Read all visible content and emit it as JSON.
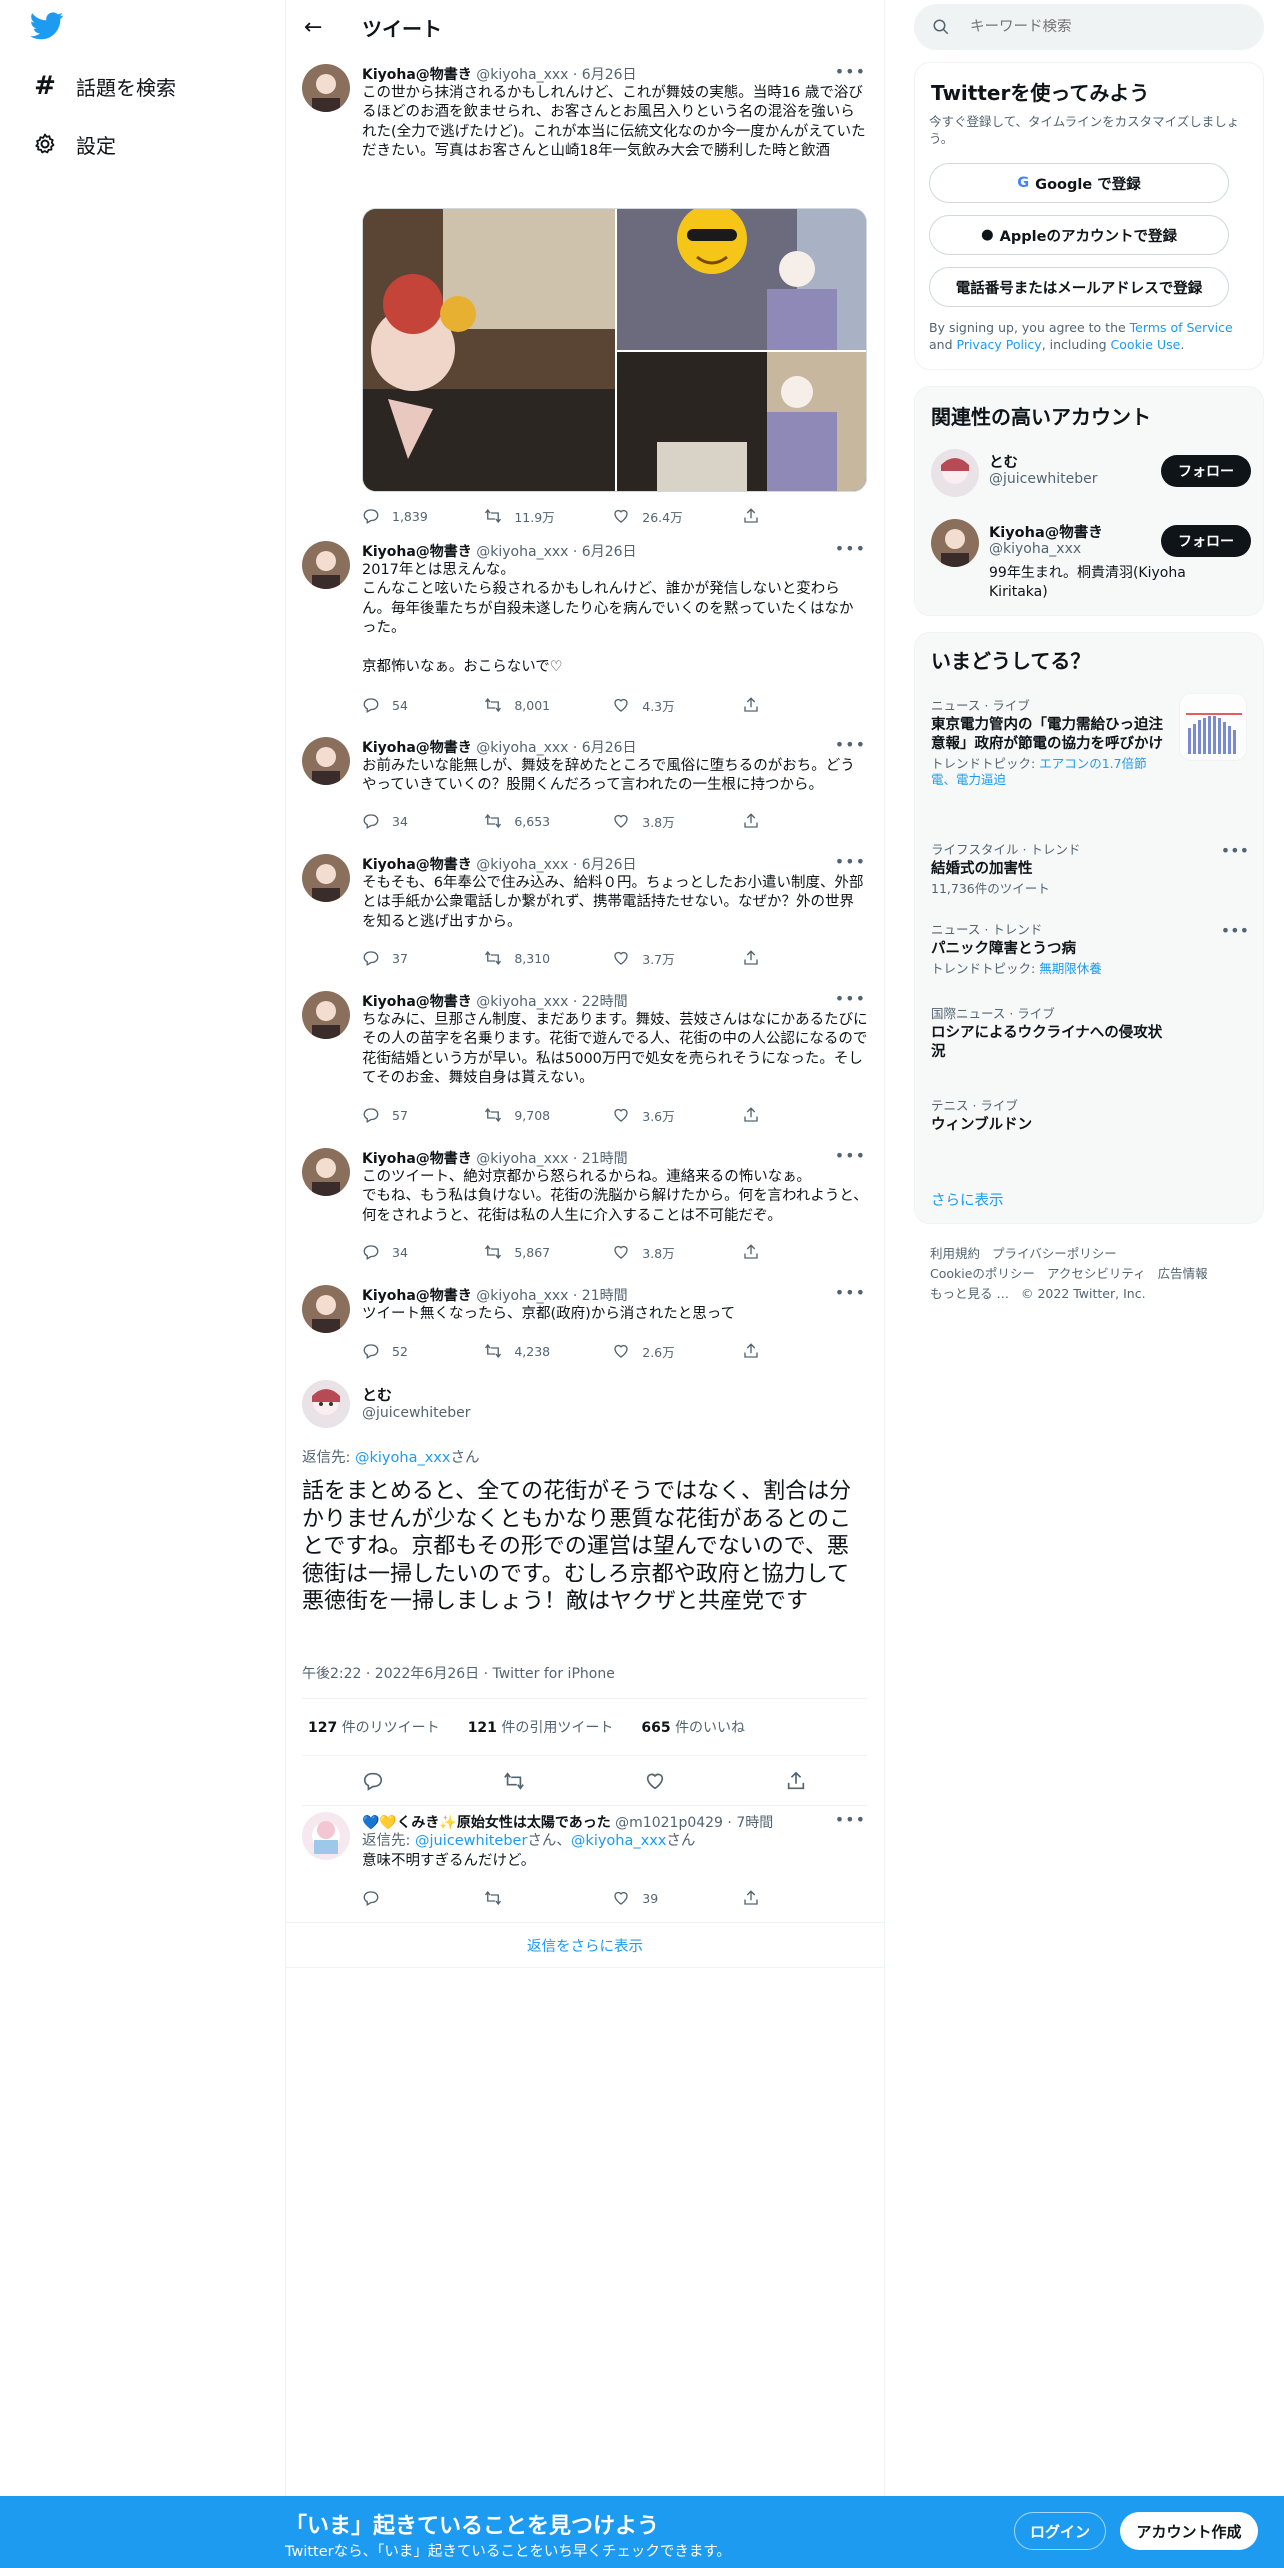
{
  "colors": {
    "accent": "#1d9bf0",
    "text": "#0f1419",
    "muted": "#536471",
    "banner": "#1d9bf0"
  },
  "nav": {
    "logo": "twitter-bird-icon",
    "items": [
      {
        "icon": "hashtag-icon",
        "label": "話題を検索"
      },
      {
        "icon": "gear-icon",
        "label": "設定"
      }
    ]
  },
  "header": {
    "title": "ツイート"
  },
  "tweets": [
    {
      "name": "Kiyoha@物書き",
      "handle": "@kiyoha_xxx",
      "time": "6月26日",
      "text": "この世から抹消されるかもしれんけど、これが舞妓の実態。当時16 歳で浴びるほどのお酒を飲ませられ、お客さんとお風呂入りという名の混浴を強いられた(全力で逃げたけど)。これが本当に伝統文化なのか今一度かんがえていただきたい。写真はお客さんと山崎18年一気飲み大会で勝利した時と飲酒",
      "replies": "1,839",
      "retweets": "11.9万",
      "likes": "26.4万"
    },
    {
      "name": "Kiyoha@物書き",
      "handle": "@kiyoha_xxx",
      "time": "6月26日",
      "text": "2017年とは思えんな。\nこんなこと呟いたら殺されるかもしれんけど、誰かが発信しないと変わらん。毎年後輩たちが自殺未遂したり心を病んでいくのを黙っていたくはなかった。\n\n京都怖いなぁ。おこらないで♡",
      "replies": "54",
      "retweets": "8,001",
      "likes": "4.3万"
    },
    {
      "name": "Kiyoha@物書き",
      "handle": "@kiyoha_xxx",
      "time": "6月26日",
      "text": "お前みたいな能無しが、舞妓を辞めたところで風俗に堕ちるのがおち。どうやっていきていくの？股開くんだろって言われたの一生根に持つから。",
      "replies": "34",
      "retweets": "6,653",
      "likes": "3.8万"
    },
    {
      "name": "Kiyoha@物書き",
      "handle": "@kiyoha_xxx",
      "time": "6月26日",
      "text": "そもそも、6年奉公で住み込み、給料０円。ちょっとしたお小遣い制度、外部とは手紙か公衆電話しか繋がれず、携帯電話持たせない。なぜか？外の世界を知ると逃げ出すから。",
      "replies": "37",
      "retweets": "8,310",
      "likes": "3.7万"
    },
    {
      "name": "Kiyoha@物書き",
      "handle": "@kiyoha_xxx",
      "time": "22時間",
      "text": "ちなみに、旦那さん制度、まだあります。舞妓、芸妓さんはなにかあるたびにその人の苗字を名乗ります。花街で遊んでる人、花街の中の人公認になるので花街結婚という方が早い。私は5000万円で処女を売られそうになった。そしてそのお金、舞妓自身は貰えない。",
      "replies": "57",
      "retweets": "9,708",
      "likes": "3.6万"
    },
    {
      "name": "Kiyoha@物書き",
      "handle": "@kiyoha_xxx",
      "time": "21時間",
      "text": "このツイート、絶対京都から怒られるからね。連絡来るの怖いなぁ。\nでもね、もう私は負けない。花街の洗脳から解けたから。何を言われようと、何をされようと、花街は私の人生に介入することは不可能だぞ。",
      "replies": "34",
      "retweets": "5,867",
      "likes": "3.8万"
    },
    {
      "name": "Kiyoha@物書き",
      "handle": "@kiyoha_xxx",
      "time": "21時間",
      "text": "ツイート無くなったら、京都(政府)から消されたと思って",
      "replies": "52",
      "retweets": "4,238",
      "likes": "2.6万"
    }
  ],
  "focus": {
    "name": "とむ",
    "handle": "@juicewhiteber",
    "reply_prefix": "返信先: ",
    "reply_to": "@kiyoha_xxx",
    "reply_suffix": "さん",
    "text": "話をまとめると、全ての花街がそうではなく、割合は分かりませんが少なくともかなり悪質な花街があるとのことですね。京都もその形での運営は望んでないので、悪徳街は一掃したいのです。むしろ京都や政府と協力して悪徳街を一掃しましょう！敵はヤクザと共産党です",
    "meta": "午後2:22 · 2022年6月26日 · Twitter for iPhone",
    "retweets_num": "127",
    "retweets_label": "件のリツイート",
    "quotes_num": "121",
    "quotes_label": "件の引用ツイート",
    "likes_num": "665",
    "likes_label": "件のいいね"
  },
  "reply": {
    "name": "💙💛くみき✨原始女性は太陽であった",
    "handle": "@m1021p0429",
    "time": "7時間",
    "reply_prefix": "返信先: ",
    "reply_to_1": "@juicewhiteber",
    "reply_mid": "さん、",
    "reply_to_2": "@kiyoha_xxx",
    "reply_suffix": "さん",
    "text": "意味不明すぎるんだけど。",
    "likes": "39"
  },
  "show_more_replies": "返信をさらに表示",
  "search": {
    "placeholder": "キーワード検索"
  },
  "signup": {
    "title": "Twitterを使ってみよう",
    "subtitle": "今すぐ登録して、タイムラインをカスタマイズしましょう。",
    "google": "Google で登録",
    "apple": "Appleのアカウントで登録",
    "phone": "電話番号またはメールアドレスで登録",
    "note_1": "By signing up, you agree to the ",
    "tos": "Terms of Service",
    "note_2": " and ",
    "privacy": "Privacy Policy",
    "note_3": ", including ",
    "cookie": "Cookie Use",
    "note_4": "."
  },
  "related": {
    "title": "関連性の高いアカウント",
    "accounts": [
      {
        "name": "とむ",
        "handle": "@juicewhiteber",
        "bio": "",
        "follow": "フォロー"
      },
      {
        "name": "Kiyoha@物書き",
        "handle": "@kiyoha_xxx",
        "bio": "99年生まれ。桐貴清羽(Kiyoha Kiritaka)",
        "follow": "フォロー"
      }
    ]
  },
  "trends": {
    "title": "いまどうしてる？",
    "items": [
      {
        "context": "ニュース · ライブ",
        "title": "東京電力管内の「電力需給ひっ迫注意報」政府が節電の協力を呼びかけ",
        "topic_prefix": "トレンドトピック: ",
        "topic": "エアコンの1.7倍節電、電力逼迫"
      },
      {
        "context": "ライフスタイル · トレンド",
        "title": "結婚式の加害性",
        "count": "11,736件のツイート"
      },
      {
        "context": "ニュース · トレンド",
        "title": "パニック障害とうつ病",
        "topic_prefix": "トレンドトピック: ",
        "topic": "無期限休養"
      },
      {
        "context": "国際ニュース · ライブ",
        "title": "ロシアによるウクライナへの侵攻状況"
      },
      {
        "context": "テニス · ライブ",
        "title": "ウィンブルドン"
      }
    ],
    "show_more": "さらに表示"
  },
  "footer": {
    "links": [
      "利用規約",
      "プライバシーポリシー",
      "Cookieのポリシー",
      "アクセシビリティ",
      "広告情報",
      "もっと見る …"
    ],
    "copyright": "© 2022 Twitter, Inc."
  },
  "banner": {
    "title": "「いま」起きていることを見つけよう",
    "subtitle": "Twitterなら、「いま」起きていることをいち早くチェックできます。",
    "login": "ログイン",
    "signup": "アカウント作成"
  }
}
